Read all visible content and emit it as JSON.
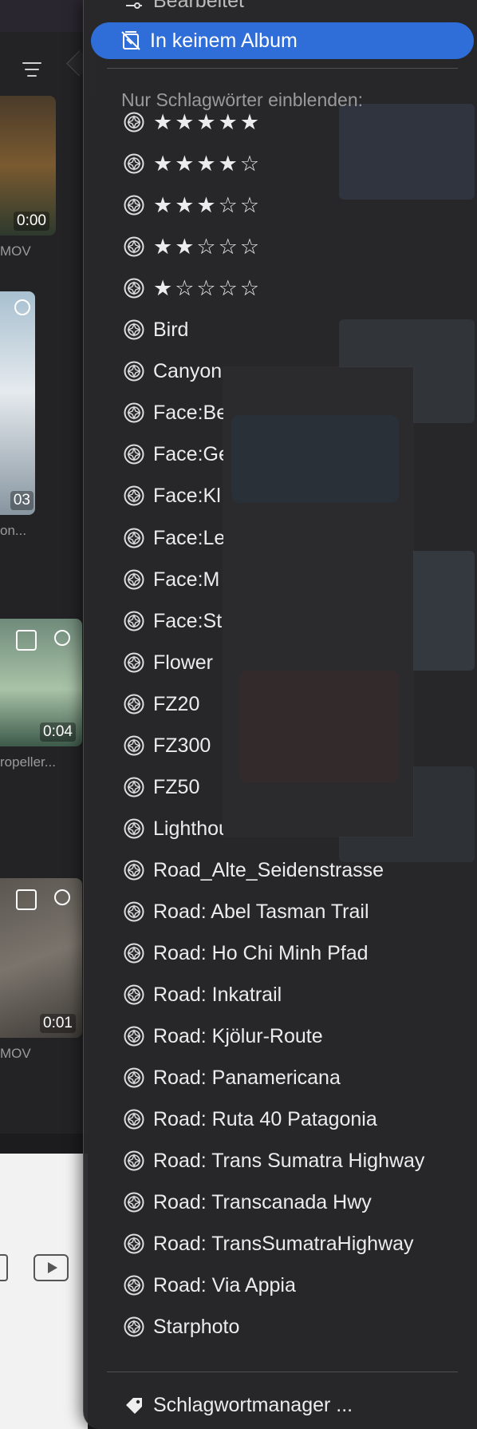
{
  "background": {
    "thumbnails": [
      {
        "duration": "0:00",
        "label": "MOV"
      },
      {
        "duration": "03",
        "label": "on..."
      },
      {
        "duration": "0:04",
        "label": "ropeller..."
      },
      {
        "duration": "0:01",
        "label": "MOV"
      }
    ]
  },
  "menu": {
    "cut_item": {
      "label": "Bearbeitet",
      "icon": "sliders-icon"
    },
    "selected_item": {
      "label": "In keinem Album",
      "icon": "album-slash-icon"
    },
    "section_header": "Nur Schlagwörter einblenden:",
    "rating_items": [
      {
        "stars": "★★★★★"
      },
      {
        "stars": "★★★★☆"
      },
      {
        "stars": "★★★☆☆"
      },
      {
        "stars": "★★☆☆☆"
      },
      {
        "stars": "★☆☆☆☆"
      }
    ],
    "keyword_items": [
      {
        "label": "Bird"
      },
      {
        "label": "Canyon"
      },
      {
        "label": "Face:Be"
      },
      {
        "label": "Face:Ge"
      },
      {
        "label": "Face:Kl"
      },
      {
        "label": "Face:Le                              er"
      },
      {
        "label": "Face:M"
      },
      {
        "label": "Face:St"
      },
      {
        "label": "Flower"
      },
      {
        "label": "FZ20"
      },
      {
        "label": "FZ300"
      },
      {
        "label": "FZ50"
      },
      {
        "label": "Lighthouse"
      },
      {
        "label": "Road_Alte_Seidenstrasse"
      },
      {
        "label": "Road: Abel Tasman Trail"
      },
      {
        "label": "Road: Ho Chi Minh Pfad"
      },
      {
        "label": "Road: Inkatrail"
      },
      {
        "label": "Road: Kjölur-Route"
      },
      {
        "label": "Road: Panamericana"
      },
      {
        "label": "Road: Ruta 40 Patagonia"
      },
      {
        "label": "Road: Trans Sumatra Highway"
      },
      {
        "label": "Road: Transcanada Hwy"
      },
      {
        "label": "Road: TransSumatraHighway"
      },
      {
        "label": "Road: Via Appia"
      },
      {
        "label": "Starphoto"
      }
    ],
    "footer_item": {
      "label": "Schlagwortmanager ...",
      "icon": "tag-icon"
    }
  },
  "colors": {
    "selection": "#2f6ed8",
    "menu_bg": "#28282a",
    "text": "#ececec",
    "header": "#9a9a9a"
  }
}
